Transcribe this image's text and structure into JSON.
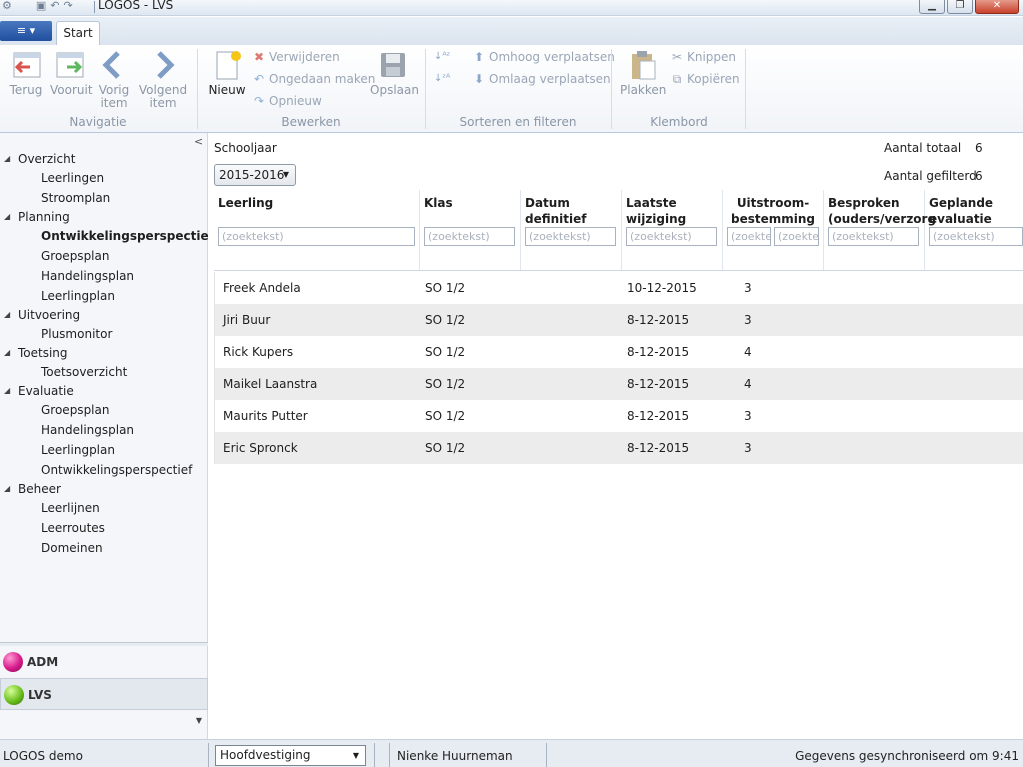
{
  "window": {
    "title": "LOGOS - LVS",
    "app_menu_label": "≡ ▾"
  },
  "tabs": [
    "Start"
  ],
  "ribbon": {
    "nav": {
      "group_label": "Navigatie",
      "back": "Terug",
      "forward": "Vooruit",
      "prev_line1": "Vorig",
      "prev_line2": "item",
      "next_line1": "Volgend",
      "next_line2": "item"
    },
    "edit": {
      "group_label": "Bewerken",
      "new": "Nieuw",
      "delete": "Verwijderen",
      "undo": "Ongedaan maken",
      "redo": "Opnieuw",
      "save": "Opslaan"
    },
    "sort": {
      "group_label": "Sorteren en filteren",
      "move_up": "Omhoog verplaatsen",
      "move_down": "Omlaag verplaatsen"
    },
    "clipboard": {
      "group_label": "Klembord",
      "paste": "Plakken",
      "cut": "Knippen",
      "copy": "Kopiëren"
    }
  },
  "sidebar": {
    "sections": [
      {
        "label": "Overzicht",
        "items": [
          {
            "label": "Leerlingen"
          },
          {
            "label": "Stroomplan"
          }
        ]
      },
      {
        "label": "Planning",
        "items": [
          {
            "label": "Ontwikkelingsperspectief",
            "selected": true
          },
          {
            "label": "Groepsplan"
          },
          {
            "label": "Handelingsplan"
          },
          {
            "label": "Leerlingplan"
          }
        ]
      },
      {
        "label": "Uitvoering",
        "items": [
          {
            "label": "Plusmonitor"
          }
        ]
      },
      {
        "label": "Toetsing",
        "items": [
          {
            "label": "Toetsoverzicht"
          }
        ]
      },
      {
        "label": "Evaluatie",
        "items": [
          {
            "label": "Groepsplan"
          },
          {
            "label": "Handelingsplan"
          },
          {
            "label": "Leerlingplan"
          },
          {
            "label": "Ontwikkelingsperspectief"
          }
        ]
      },
      {
        "label": "Beheer",
        "items": [
          {
            "label": "Leerlijnen"
          },
          {
            "label": "Leerroutes"
          },
          {
            "label": "Domeinen"
          }
        ]
      }
    ],
    "modules": [
      {
        "label": "ADM",
        "color": "#d81b8c"
      },
      {
        "label": "LVS",
        "color": "#6cbf1e",
        "active": true
      }
    ]
  },
  "main": {
    "schooljaar_label": "Schooljaar",
    "schooljaar_value": "2015-2016",
    "total_label": "Aantal totaal",
    "total_value": "6",
    "filtered_label": "Aantal gefilterd",
    "filtered_value": "6",
    "filter_placeholder": "(zoektekst)",
    "filter_placeholder_short": "(zoekte",
    "columns": {
      "leerling": "Leerling",
      "klas": "Klas",
      "datum_l1": "Datum",
      "datum_l2": "definitief",
      "laatste_l1": "Laatste",
      "laatste_l2": "wijziging",
      "uitstroom_l1": "Uitstroom-",
      "uitstroom_l2": "bestemming",
      "besproken_l1": "Besproken",
      "besproken_l2": "(ouders/verzorg",
      "geplande_l1": "Geplande",
      "geplande_l2": "evaluatie"
    },
    "rows": [
      {
        "leerling": "Freek Andela",
        "klas": "SO 1/2",
        "datum_definitief": "",
        "laatste_wijziging": "10-12-2015",
        "uitstroom": "3"
      },
      {
        "leerling": "Jiri Buur",
        "klas": "SO 1/2",
        "datum_definitief": "",
        "laatste_wijziging": "8-12-2015",
        "uitstroom": "3"
      },
      {
        "leerling": "Rick Kupers",
        "klas": "SO 1/2",
        "datum_definitief": "",
        "laatste_wijziging": "8-12-2015",
        "uitstroom": "4"
      },
      {
        "leerling": "Maikel Laanstra",
        "klas": "SO 1/2",
        "datum_definitief": "",
        "laatste_wijziging": "8-12-2015",
        "uitstroom": "4"
      },
      {
        "leerling": "Maurits Putter",
        "klas": "SO 1/2",
        "datum_definitief": "",
        "laatste_wijziging": "8-12-2015",
        "uitstroom": "3"
      },
      {
        "leerling": "Eric Spronck",
        "klas": "SO 1/2",
        "datum_definitief": "",
        "laatste_wijziging": "8-12-2015",
        "uitstroom": "3"
      }
    ]
  },
  "statusbar": {
    "app": "LOGOS demo",
    "location": "Hoofdvestiging",
    "user": "Nienke Huurneman",
    "sync": "Gegevens gesynchroniseerd om 9:41"
  }
}
